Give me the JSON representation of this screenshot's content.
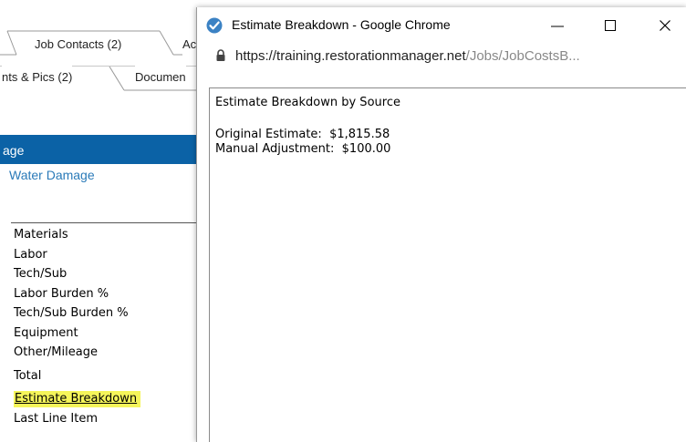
{
  "background_app": {
    "tabs_row1": [
      "Job Contacts (2)",
      "Ac"
    ],
    "tabs_row2": [
      "nts & Pics (2)",
      "Documen"
    ],
    "section_header": "age",
    "link_water_damage": "Water Damage",
    "cost_items": [
      "Materials",
      "Labor",
      "Tech/Sub",
      "Labor Burden %",
      "Tech/Sub Burden %",
      "Equipment",
      "Other/Mileage",
      "Total",
      "Estimate Breakdown",
      "Last Line Item"
    ],
    "highlight_color": "#f5f55a",
    "accent_color": "#0b62a6"
  },
  "popup": {
    "title": "Estimate Breakdown - Google Chrome",
    "app_icon": "chrome-icon",
    "url_host": "https://training.restorationmanager.net",
    "url_path": "/Jobs/JobCostsB...",
    "heading": "Estimate Breakdown by Source",
    "rows": [
      {
        "label": "Original Estimate:",
        "value": "$1,815.58"
      },
      {
        "label": "Manual Adjustment:",
        "value": "$100.00"
      }
    ]
  }
}
